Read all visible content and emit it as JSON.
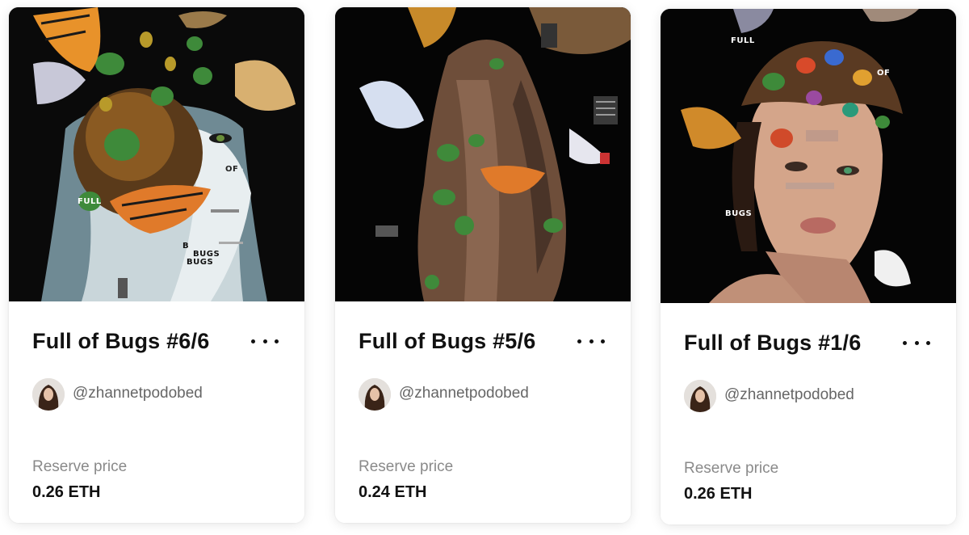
{
  "cards": [
    {
      "title": "Full of Bugs #6/6",
      "creator": "@zhannetpodobed",
      "price_label": "Reserve price",
      "price": "0.26 ETH",
      "art_words": [
        "FULL",
        "OF",
        "B",
        "BUGS",
        "BUGS"
      ]
    },
    {
      "title": "Full of Bugs #5/6",
      "creator": "@zhannetpodobed",
      "price_label": "Reserve price",
      "price": "0.24 ETH",
      "art_words": []
    },
    {
      "title": "Full of Bugs #1/6",
      "creator": "@zhannetpodobed",
      "price_label": "Reserve price",
      "price": "0.26 ETH",
      "art_words": [
        "FULL",
        "OF",
        "BUGS"
      ]
    }
  ],
  "icons": {
    "more": "more-dots-icon"
  }
}
